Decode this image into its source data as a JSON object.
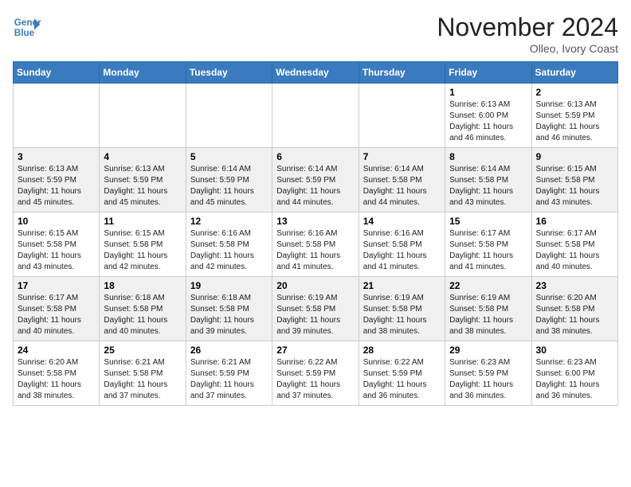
{
  "header": {
    "logo_line1": "General",
    "logo_line2": "Blue",
    "month": "November 2024",
    "location": "Olleo, Ivory Coast"
  },
  "weekdays": [
    "Sunday",
    "Monday",
    "Tuesday",
    "Wednesday",
    "Thursday",
    "Friday",
    "Saturday"
  ],
  "weeks": [
    [
      {
        "day": "",
        "info": ""
      },
      {
        "day": "",
        "info": ""
      },
      {
        "day": "",
        "info": ""
      },
      {
        "day": "",
        "info": ""
      },
      {
        "day": "",
        "info": ""
      },
      {
        "day": "1",
        "info": "Sunrise: 6:13 AM\nSunset: 6:00 PM\nDaylight: 11 hours\nand 46 minutes."
      },
      {
        "day": "2",
        "info": "Sunrise: 6:13 AM\nSunset: 5:59 PM\nDaylight: 11 hours\nand 46 minutes."
      }
    ],
    [
      {
        "day": "3",
        "info": "Sunrise: 6:13 AM\nSunset: 5:59 PM\nDaylight: 11 hours\nand 45 minutes."
      },
      {
        "day": "4",
        "info": "Sunrise: 6:13 AM\nSunset: 5:59 PM\nDaylight: 11 hours\nand 45 minutes."
      },
      {
        "day": "5",
        "info": "Sunrise: 6:14 AM\nSunset: 5:59 PM\nDaylight: 11 hours\nand 45 minutes."
      },
      {
        "day": "6",
        "info": "Sunrise: 6:14 AM\nSunset: 5:59 PM\nDaylight: 11 hours\nand 44 minutes."
      },
      {
        "day": "7",
        "info": "Sunrise: 6:14 AM\nSunset: 5:58 PM\nDaylight: 11 hours\nand 44 minutes."
      },
      {
        "day": "8",
        "info": "Sunrise: 6:14 AM\nSunset: 5:58 PM\nDaylight: 11 hours\nand 43 minutes."
      },
      {
        "day": "9",
        "info": "Sunrise: 6:15 AM\nSunset: 5:58 PM\nDaylight: 11 hours\nand 43 minutes."
      }
    ],
    [
      {
        "day": "10",
        "info": "Sunrise: 6:15 AM\nSunset: 5:58 PM\nDaylight: 11 hours\nand 43 minutes."
      },
      {
        "day": "11",
        "info": "Sunrise: 6:15 AM\nSunset: 5:58 PM\nDaylight: 11 hours\nand 42 minutes."
      },
      {
        "day": "12",
        "info": "Sunrise: 6:16 AM\nSunset: 5:58 PM\nDaylight: 11 hours\nand 42 minutes."
      },
      {
        "day": "13",
        "info": "Sunrise: 6:16 AM\nSunset: 5:58 PM\nDaylight: 11 hours\nand 41 minutes."
      },
      {
        "day": "14",
        "info": "Sunrise: 6:16 AM\nSunset: 5:58 PM\nDaylight: 11 hours\nand 41 minutes."
      },
      {
        "day": "15",
        "info": "Sunrise: 6:17 AM\nSunset: 5:58 PM\nDaylight: 11 hours\nand 41 minutes."
      },
      {
        "day": "16",
        "info": "Sunrise: 6:17 AM\nSunset: 5:58 PM\nDaylight: 11 hours\nand 40 minutes."
      }
    ],
    [
      {
        "day": "17",
        "info": "Sunrise: 6:17 AM\nSunset: 5:58 PM\nDaylight: 11 hours\nand 40 minutes."
      },
      {
        "day": "18",
        "info": "Sunrise: 6:18 AM\nSunset: 5:58 PM\nDaylight: 11 hours\nand 40 minutes."
      },
      {
        "day": "19",
        "info": "Sunrise: 6:18 AM\nSunset: 5:58 PM\nDaylight: 11 hours\nand 39 minutes."
      },
      {
        "day": "20",
        "info": "Sunrise: 6:19 AM\nSunset: 5:58 PM\nDaylight: 11 hours\nand 39 minutes."
      },
      {
        "day": "21",
        "info": "Sunrise: 6:19 AM\nSunset: 5:58 PM\nDaylight: 11 hours\nand 38 minutes."
      },
      {
        "day": "22",
        "info": "Sunrise: 6:19 AM\nSunset: 5:58 PM\nDaylight: 11 hours\nand 38 minutes."
      },
      {
        "day": "23",
        "info": "Sunrise: 6:20 AM\nSunset: 5:58 PM\nDaylight: 11 hours\nand 38 minutes."
      }
    ],
    [
      {
        "day": "24",
        "info": "Sunrise: 6:20 AM\nSunset: 5:58 PM\nDaylight: 11 hours\nand 38 minutes."
      },
      {
        "day": "25",
        "info": "Sunrise: 6:21 AM\nSunset: 5:58 PM\nDaylight: 11 hours\nand 37 minutes."
      },
      {
        "day": "26",
        "info": "Sunrise: 6:21 AM\nSunset: 5:59 PM\nDaylight: 11 hours\nand 37 minutes."
      },
      {
        "day": "27",
        "info": "Sunrise: 6:22 AM\nSunset: 5:59 PM\nDaylight: 11 hours\nand 37 minutes."
      },
      {
        "day": "28",
        "info": "Sunrise: 6:22 AM\nSunset: 5:59 PM\nDaylight: 11 hours\nand 36 minutes."
      },
      {
        "day": "29",
        "info": "Sunrise: 6:23 AM\nSunset: 5:59 PM\nDaylight: 11 hours\nand 36 minutes."
      },
      {
        "day": "30",
        "info": "Sunrise: 6:23 AM\nSunset: 6:00 PM\nDaylight: 11 hours\nand 36 minutes."
      }
    ]
  ]
}
